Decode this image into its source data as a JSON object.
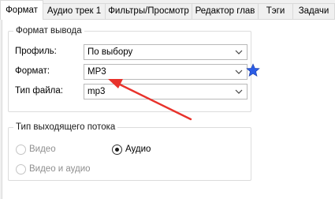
{
  "tabs": [
    {
      "label": "Формат",
      "active": true
    },
    {
      "label": "Аудио трек 1",
      "active": false
    },
    {
      "label": "Фильтры/Просмотр",
      "active": false
    },
    {
      "label": "Редактор глав",
      "active": false
    },
    {
      "label": "Тэги",
      "active": false
    },
    {
      "label": "Задачи",
      "active": false
    }
  ],
  "output_format": {
    "title": "Формат вывода",
    "profile_label": "Профиль:",
    "profile_value": "По выбору",
    "format_label": "Формат:",
    "format_value": "MP3",
    "filetype_label": "Тип файла:",
    "filetype_value": "mp3",
    "favorite_icon": "star-icon"
  },
  "stream_type": {
    "title": "Тип выходящего потока",
    "options": [
      {
        "label": "Видео",
        "checked": false,
        "enabled": false
      },
      {
        "label": "Аудио",
        "checked": true,
        "enabled": true
      },
      {
        "label": "Видео и аудио",
        "checked": false,
        "enabled": false
      }
    ]
  },
  "colors": {
    "star": "#2b5ce6",
    "arrow": "#e8322b",
    "panel_bg": "#ffffff",
    "window_bg": "#f0f0f0"
  }
}
